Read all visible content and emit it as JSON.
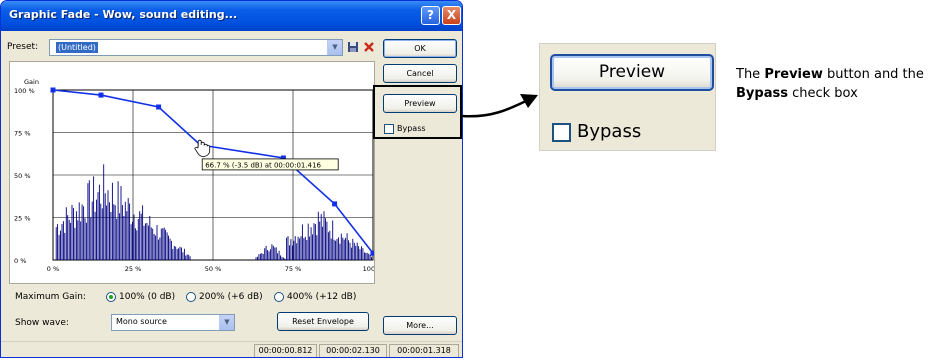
{
  "dialog": {
    "title": "Graphic Fade - Wow, sound editing...",
    "help_button": "?",
    "close_button": "X",
    "preset_label": "Preset:",
    "preset_value": "(Untitled)",
    "buttons": {
      "ok": "OK",
      "cancel": "Cancel",
      "preview": "Preview",
      "reset_envelope": "Reset Envelope",
      "more": "More..."
    },
    "bypass_label": "Bypass",
    "maximum_gain_label": "Maximum Gain:",
    "gain_options": [
      "100% (0 dB)",
      "200% (+6 dB)",
      "400% (+12 dB)"
    ],
    "gain_selected_index": 0,
    "show_wave_label": "Show wave:",
    "show_wave_value": "Mono source",
    "status": [
      "00:00:00.812",
      "00:00:02.130",
      "00:00:01.318"
    ]
  },
  "envelope": {
    "y_axis_title": "Gain",
    "y_ticks": [
      "100 %",
      "75 %",
      "50 %",
      "25 %",
      "0 %"
    ],
    "x_ticks": [
      "0 %",
      "25 %",
      "50 %",
      "75 %",
      "100 %"
    ],
    "points": [
      {
        "x": 0,
        "y": 100
      },
      {
        "x": 15,
        "y": 97
      },
      {
        "x": 33,
        "y": 90
      },
      {
        "x": 46,
        "y": 67.7
      },
      {
        "x": 72,
        "y": 60
      },
      {
        "x": 88,
        "y": 33
      },
      {
        "x": 100,
        "y": 4
      }
    ],
    "tooltip": "66.7 % (-3.5 dB) at 00:00:01.416",
    "line_color": "#1230e8",
    "wave_color": "#000080",
    "wave_segments": [
      {
        "from": 1,
        "to": 43,
        "center": 16,
        "peak": 57
      },
      {
        "from": 63,
        "to": 73,
        "center": 68,
        "peak": 12
      },
      {
        "from": 73,
        "to": 100,
        "center": 83,
        "peak": 33
      }
    ]
  },
  "zoom": {
    "preview_label": "Preview",
    "bypass_label": "Bypass"
  },
  "caption": {
    "part1": "The ",
    "bold1": "Preview",
    "part2": " button and the ",
    "bold2": "Bypass",
    "part3": " check box"
  }
}
